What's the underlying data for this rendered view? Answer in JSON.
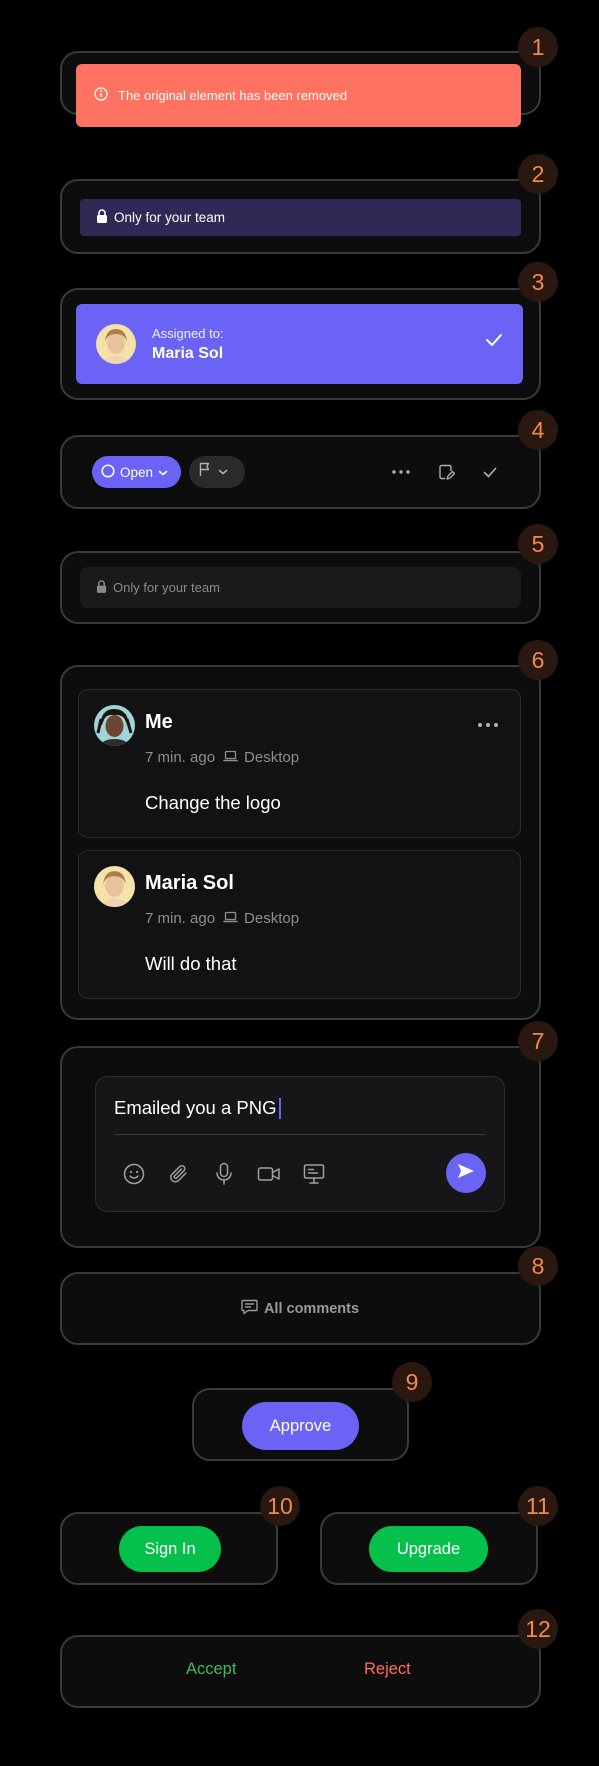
{
  "badges": [
    "1",
    "2",
    "3",
    "4",
    "5",
    "6",
    "7",
    "8",
    "9",
    "10",
    "11",
    "12"
  ],
  "removed_banner": {
    "icon": "info-icon",
    "text": "The original element has been removed"
  },
  "team_banner_dark": {
    "icon": "lock-icon",
    "text": "Only for your team"
  },
  "assigned": {
    "label": "Assigned to:",
    "name": "Maria Sol",
    "icon": "check-icon"
  },
  "status_toolbar": {
    "status_label": "Open",
    "icons": [
      "circle-icon",
      "chevron-down-icon",
      "flag-icon",
      "more-icon",
      "edit-note-icon",
      "check-icon"
    ]
  },
  "team_banner_light": {
    "icon": "lock-icon",
    "text": "Only for your team"
  },
  "comments": [
    {
      "author": "Me",
      "time": "7 min. ago",
      "device": "Desktop",
      "body": "Change the logo"
    },
    {
      "author": "Maria Sol",
      "time": "7 min. ago",
      "device": "Desktop",
      "body": "Will do that"
    }
  ],
  "composer": {
    "value": "Emailed you a PNG",
    "tools": [
      "emoji-icon",
      "attachment-icon",
      "microphone-icon",
      "video-icon",
      "screen-share-icon"
    ],
    "send_icon": "send-icon"
  },
  "all_comments": {
    "icon": "comments-icon",
    "label": "All comments"
  },
  "buttons": {
    "approve": "Approve",
    "sign_in": "Sign In",
    "upgrade": "Upgrade",
    "accept": "Accept",
    "reject": "Reject"
  },
  "colors": {
    "accent": "#6b63f5",
    "danger": "#ff7262",
    "success": "#05c04a",
    "badge_text": "#f08a4b",
    "frame_border": "#3a3a3c"
  }
}
